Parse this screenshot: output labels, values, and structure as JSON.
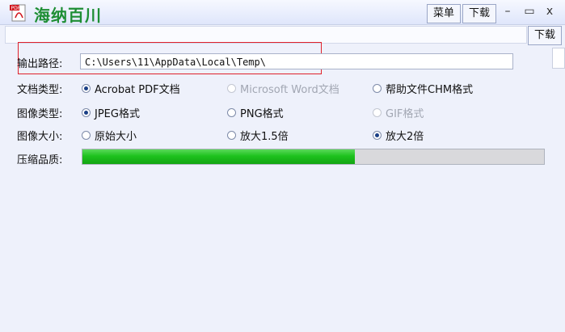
{
  "window": {
    "title": "海纳百川",
    "menu_label": "菜单",
    "download_label": "下载",
    "minimize": "–",
    "maximize": "▭",
    "close": "x"
  },
  "url_bar": {
    "value": "",
    "download_label": "下载"
  },
  "output_path": {
    "label": "输出路径:",
    "value": "C:\\Users\\11\\AppData\\Local\\Temp\\"
  },
  "doc_type": {
    "label": "文档类型:",
    "options": [
      {
        "label": "Acrobat PDF文档",
        "checked": true,
        "disabled": false
      },
      {
        "label": "Microsoft Word文档",
        "checked": false,
        "disabled": true
      },
      {
        "label": "帮助文件CHM格式",
        "checked": false,
        "disabled": false
      }
    ]
  },
  "image_type": {
    "label": "图像类型:",
    "options": [
      {
        "label": "JPEG格式",
        "checked": true,
        "disabled": false
      },
      {
        "label": "PNG格式",
        "checked": false,
        "disabled": false
      },
      {
        "label": "GIF格式",
        "checked": false,
        "disabled": true
      }
    ]
  },
  "image_size": {
    "label": "图像大小:",
    "options": [
      {
        "label": "原始大小",
        "checked": false,
        "disabled": false
      },
      {
        "label": "放大1.5倍",
        "checked": false,
        "disabled": false
      },
      {
        "label": "放大2倍",
        "checked": true,
        "disabled": false
      }
    ]
  },
  "quality": {
    "label": "压缩品质:",
    "percent": 59
  },
  "colors": {
    "accent_green": "#1ec21e",
    "title_green": "#1e8e34",
    "highlight_red": "#e0212b"
  }
}
